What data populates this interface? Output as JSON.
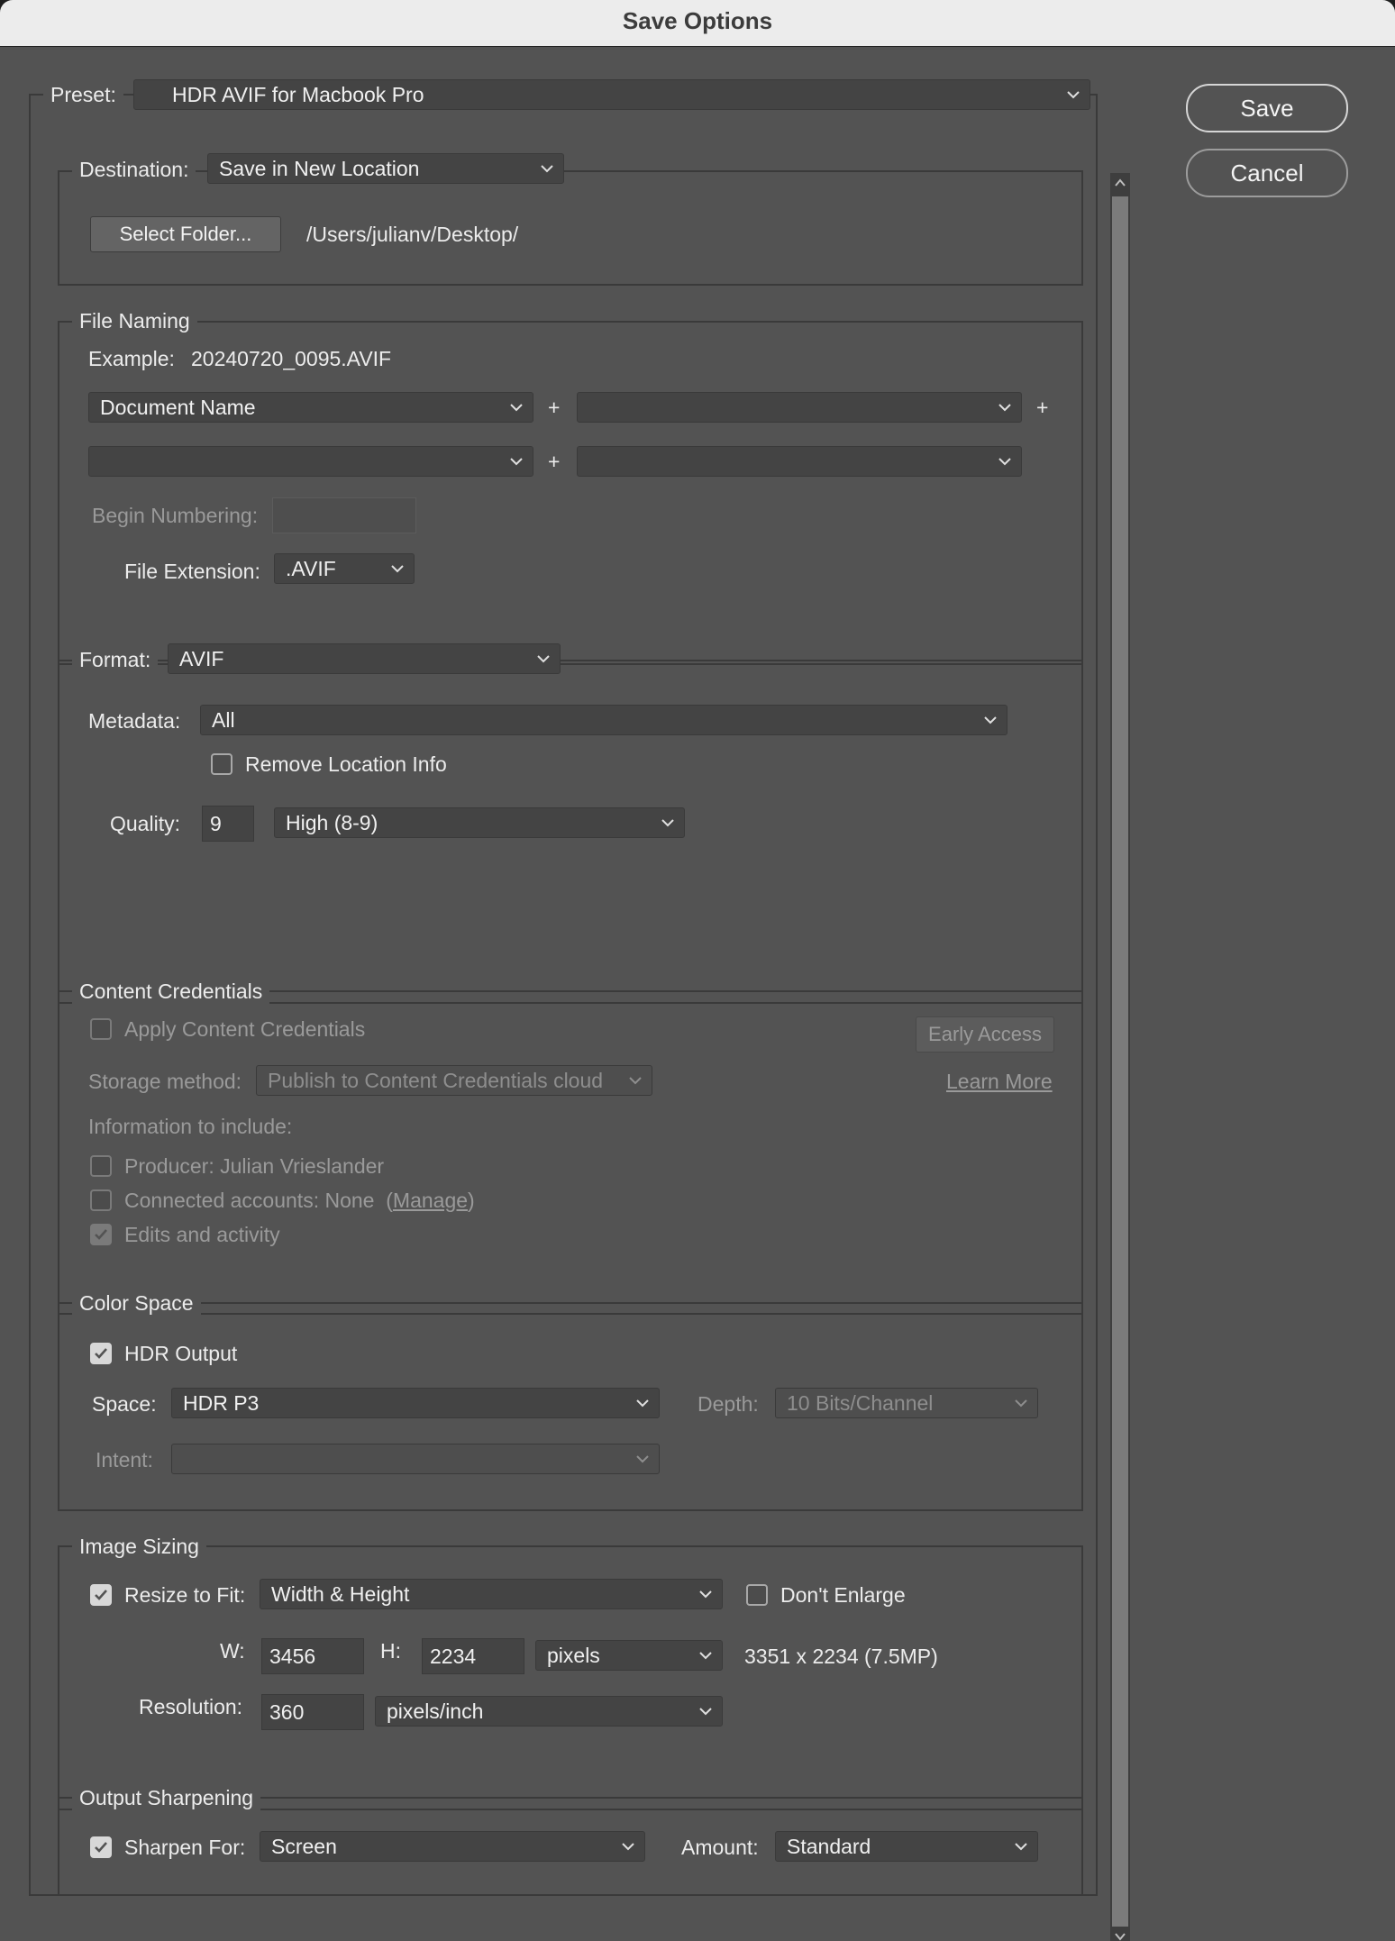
{
  "window": {
    "title": "Save Options"
  },
  "buttons": {
    "save": "Save",
    "cancel": "Cancel"
  },
  "preset": {
    "label": "Preset:",
    "value": "HDR AVIF for Macbook Pro"
  },
  "destination": {
    "label": "Destination:",
    "value": "Save in New Location",
    "select_folder": "Select Folder...",
    "path": "/Users/julianv/Desktop/"
  },
  "file_naming": {
    "title": "File Naming",
    "example_label": "Example:",
    "example_value": "20240720_0095.AVIF",
    "field1": "Document Name",
    "field2": "",
    "field3": "",
    "field4": "",
    "plus": "+",
    "begin_numbering_label": "Begin Numbering:",
    "begin_numbering_value": "",
    "extension_label": "File Extension:",
    "extension_value": ".AVIF"
  },
  "format": {
    "label": "Format:",
    "value": "AVIF",
    "metadata_label": "Metadata:",
    "metadata_value": "All",
    "remove_location": "Remove Location Info",
    "remove_location_checked": false,
    "quality_label": "Quality:",
    "quality_value": "9",
    "quality_level": "High (8-9)"
  },
  "content_credentials": {
    "title": "Content Credentials",
    "apply": "Apply Content Credentials",
    "early_access": "Early Access",
    "storage_label": "Storage method:",
    "storage_value": "Publish to Content Credentials cloud",
    "learn_more": "Learn More",
    "info_label": "Information to include:",
    "producer": "Producer: Julian Vrieslander",
    "connected_prefix": "Connected accounts: None  (",
    "manage": "Manage",
    "connected_suffix": ")",
    "edits": "Edits and activity"
  },
  "color_space": {
    "title": "Color Space",
    "hdr_output": "HDR Output",
    "hdr_checked": true,
    "space_label": "Space:",
    "space_value": "HDR P3",
    "depth_label": "Depth:",
    "depth_value": "10 Bits/Channel",
    "intent_label": "Intent:",
    "intent_value": ""
  },
  "image_sizing": {
    "title": "Image Sizing",
    "resize_label": "Resize to Fit:",
    "resize_checked": true,
    "resize_value": "Width & Height",
    "dont_enlarge": "Don't Enlarge",
    "dont_enlarge_checked": false,
    "w_label": "W:",
    "w_value": "3456",
    "h_label": "H:",
    "h_value": "2234",
    "unit": "pixels",
    "result": "3351 x 2234 (7.5MP)",
    "resolution_label": "Resolution:",
    "resolution_value": "360",
    "resolution_unit": "pixels/inch"
  },
  "output_sharpening": {
    "title": "Output Sharpening",
    "sharpen_label": "Sharpen For:",
    "sharpen_checked": true,
    "sharpen_value": "Screen",
    "amount_label": "Amount:",
    "amount_value": "Standard"
  }
}
